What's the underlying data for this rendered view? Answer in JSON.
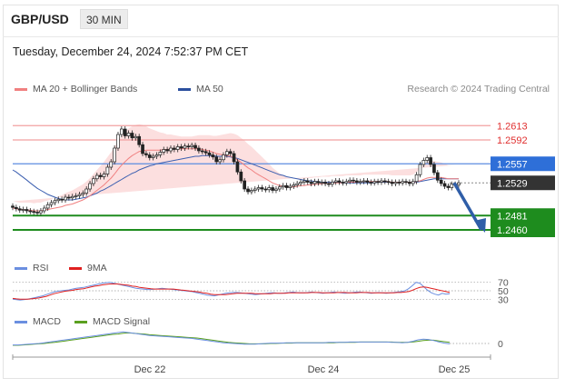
{
  "header": {
    "pair": "GBP/USD",
    "timeframe": "30 MIN",
    "datetime": "Tuesday, December 24, 2024 7:52:37 PM CET"
  },
  "legends": {
    "main": [
      {
        "label": "MA 20 + Bollinger Bands",
        "color": "#f08080"
      },
      {
        "label": "MA 50",
        "color": "#2b4f9e"
      }
    ],
    "rsi": [
      {
        "label": "RSI",
        "color": "#6b8fe0"
      },
      {
        "label": "9MA",
        "color": "#e02020"
      }
    ],
    "macd": [
      {
        "label": "MACD",
        "color": "#6b8fe0"
      },
      {
        "label": "MACD Signal",
        "color": "#5aa020"
      }
    ]
  },
  "watermark": "Research © 2024 Trading Central",
  "chart_data": {
    "type": "candlestick",
    "ylim": [
      1.244,
      1.264
    ],
    "x_ticks": [
      "Dec 22",
      "Dec 24",
      "Dec 25"
    ],
    "levels": [
      {
        "value": "1.2613",
        "kind": "resistance",
        "color": "#e03030"
      },
      {
        "value": "1.2592",
        "kind": "resistance",
        "color": "#e03030"
      },
      {
        "value": "1.2557",
        "kind": "pivot",
        "color": "#2e6fd8"
      },
      {
        "value": "1.2529",
        "kind": "last",
        "color": "#333333"
      },
      {
        "value": "1.2481",
        "kind": "support",
        "color": "#1e8c1e"
      },
      {
        "value": "1.2460",
        "kind": "support",
        "color": "#1e8c1e"
      }
    ],
    "close": [
      1.2493,
      1.2491,
      1.2489,
      1.249,
      1.2488,
      1.2487,
      1.2486,
      1.2485,
      1.2488,
      1.2492,
      1.2497,
      1.25,
      1.2503,
      1.2505,
      1.2504,
      1.2508,
      1.2507,
      1.2509,
      1.251,
      1.2512,
      1.2514,
      1.252,
      1.2528,
      1.2535,
      1.254,
      1.2538,
      1.2542,
      1.2552,
      1.256,
      1.258,
      1.26,
      1.2608,
      1.2598,
      1.2602,
      1.2595,
      1.2597,
      1.2585,
      1.2572,
      1.257,
      1.2566,
      1.2568,
      1.257,
      1.2574,
      1.2578,
      1.2576,
      1.258,
      1.2578,
      1.2582,
      1.258,
      1.2583,
      1.2582,
      1.2584,
      1.258,
      1.2576,
      1.2575,
      1.2573,
      1.257,
      1.2567,
      1.256,
      1.2563,
      1.257,
      1.2575,
      1.2572,
      1.256,
      1.2545,
      1.2532,
      1.252,
      1.2516,
      1.2518,
      1.252,
      1.2522,
      1.252,
      1.2519,
      1.2522,
      1.2518,
      1.252,
      1.2523,
      1.2525,
      1.2522,
      1.2524,
      1.2526,
      1.2528,
      1.253,
      1.2532,
      1.253,
      1.2528,
      1.2531,
      1.2529,
      1.253,
      1.2528,
      1.2527,
      1.253,
      1.2532,
      1.253,
      1.2529,
      1.2531,
      1.2533,
      1.2532,
      1.253,
      1.2531,
      1.2532,
      1.253,
      1.2529,
      1.2531,
      1.253,
      1.2532,
      1.2531,
      1.253,
      1.2528,
      1.253,
      1.2529,
      1.2531,
      1.253,
      1.2528,
      1.2531,
      1.2541,
      1.2556,
      1.2562,
      1.2566,
      1.2556,
      1.2544,
      1.2533,
      1.2528,
      1.2524,
      1.2522,
      1.2527,
      1.2526,
      1.2529
    ],
    "ma20": [
      1.2492,
      1.2491,
      1.249,
      1.249,
      1.2489,
      1.2489,
      1.2488,
      1.2488,
      1.2488,
      1.2489,
      1.249,
      1.2491,
      1.2492,
      1.2493,
      1.2494,
      1.2496,
      1.2497,
      1.2498,
      1.25,
      1.2502,
      1.2504,
      1.2507,
      1.251,
      1.2514,
      1.2518,
      1.2522,
      1.2526,
      1.2531,
      1.2536,
      1.2542,
      1.2549,
      1.2555,
      1.256,
      1.2565,
      1.2569,
      1.2572,
      1.2575,
      1.2576,
      1.2577,
      1.2577,
      1.2577,
      1.2577,
      1.2577,
      1.2578,
      1.2578,
      1.2579,
      1.2579,
      1.2579,
      1.2579,
      1.2579,
      1.2579,
      1.2579,
      1.2579,
      1.2579,
      1.2578,
      1.2577,
      1.2576,
      1.2574,
      1.2572,
      1.2571,
      1.257,
      1.2569,
      1.2568,
      1.2566,
      1.2563,
      1.2559,
      1.2555,
      1.2551,
      1.2548,
      1.2544,
      1.2541,
      1.2538,
      1.2535,
      1.2532,
      1.2529,
      1.2527,
      1.2525,
      1.2524,
      1.2523,
      1.2523,
      1.2523,
      1.2524,
      1.2525,
      1.2525,
      1.2526,
      1.2526,
      1.2527,
      1.2527,
      1.2528,
      1.2528,
      1.2528,
      1.2529,
      1.2529,
      1.2529,
      1.2529,
      1.253,
      1.253,
      1.253,
      1.253,
      1.253,
      1.2531,
      1.2531,
      1.2531,
      1.2531,
      1.2531,
      1.2531,
      1.2531,
      1.2531,
      1.253,
      1.253,
      1.253,
      1.253,
      1.253,
      1.253,
      1.253,
      1.2531,
      1.2532,
      1.2534,
      1.2536,
      1.2537,
      1.2537,
      1.2537,
      1.2537,
      1.2536,
      1.2535,
      1.2535,
      1.2535,
      1.2535
    ],
    "ma50": [
      1.2548,
      1.2545,
      1.2541,
      1.2537,
      1.2533,
      1.2529,
      1.2525,
      1.2521,
      1.2518,
      1.2515,
      1.2512,
      1.251,
      1.2508,
      1.2506,
      1.2505,
      1.2504,
      1.2504,
      1.2504,
      1.2505,
      1.2506,
      1.2507,
      1.2508,
      1.251,
      1.2512,
      1.2514,
      1.2517,
      1.2519,
      1.2522,
      1.2525,
      1.2528,
      1.2531,
      1.2534,
      1.2537,
      1.254,
      1.2543,
      1.2545,
      1.2548,
      1.255,
      1.2552,
      1.2554,
      1.2555,
      1.2557,
      1.2558,
      1.2559,
      1.256,
      1.2561,
      1.2562,
      1.2563,
      1.2564,
      1.2565,
      1.2566,
      1.2567,
      1.2568,
      1.2568,
      1.2569,
      1.2569,
      1.2569,
      1.2569,
      1.2568,
      1.2568,
      1.2568,
      1.2568,
      1.2567,
      1.2566,
      1.2565,
      1.2563,
      1.2561,
      1.2559,
      1.2557,
      1.2555,
      1.2553,
      1.2551,
      1.2549,
      1.2547,
      1.2545,
      1.2543,
      1.2541,
      1.254,
      1.2538,
      1.2537,
      1.2536,
      1.2535,
      1.2534,
      1.2533,
      1.2532,
      1.2532,
      1.2531,
      1.2531,
      1.253,
      1.253,
      1.253,
      1.253,
      1.253,
      1.2529,
      1.2529,
      1.2529,
      1.2529,
      1.2529,
      1.2529,
      1.2529,
      1.2529,
      1.2529,
      1.2529,
      1.2529,
      1.253,
      1.253,
      1.253,
      1.253,
      1.253,
      1.253,
      1.253,
      1.253,
      1.253,
      1.253,
      1.253,
      1.253,
      1.2531,
      1.2532,
      1.2533,
      1.2534,
      1.2535,
      1.2535,
      1.2535,
      1.2535,
      1.2535,
      1.2535,
      1.2535,
      1.2535
    ],
    "band_width": [
      0.001,
      0.001,
      0.001,
      0.001,
      0.0011,
      0.0011,
      0.0011,
      0.0012,
      0.0012,
      0.0013,
      0.0013,
      0.0014,
      0.0015,
      0.0016,
      0.0017,
      0.0018,
      0.0019,
      0.002,
      0.0021,
      0.0022,
      0.0023,
      0.0024,
      0.0026,
      0.0028,
      0.003,
      0.0032,
      0.0034,
      0.0036,
      0.0038,
      0.004,
      0.0042,
      0.0043,
      0.0044,
      0.0044,
      0.0043,
      0.0042,
      0.004,
      0.0038,
      0.0035,
      0.0032,
      0.003,
      0.0028,
      0.0026,
      0.0024,
      0.0022,
      0.0021,
      0.002,
      0.0019,
      0.0018,
      0.0018,
      0.0018,
      0.0018,
      0.0019,
      0.002,
      0.0021,
      0.0022,
      0.0023,
      0.0024,
      0.0026,
      0.0028,
      0.003,
      0.0032,
      0.0034,
      0.0035,
      0.0036,
      0.0036,
      0.0036,
      0.0035,
      0.0034,
      0.0033,
      0.0031,
      0.0029,
      0.0027,
      0.0025,
      0.0022,
      0.002,
      0.0018,
      0.0016,
      0.0014,
      0.0013,
      0.0012,
      0.0011,
      0.001,
      0.001,
      0.001,
      0.001,
      0.001,
      0.001,
      0.001,
      0.001,
      0.001,
      0.001,
      0.001,
      0.001,
      0.001,
      0.001,
      0.001,
      0.001,
      0.001,
      0.001,
      0.001,
      0.001,
      0.001,
      0.001,
      0.001,
      0.001,
      0.001,
      0.001,
      0.001,
      0.001,
      0.001,
      0.001,
      0.001,
      0.001,
      0.0011,
      0.0014,
      0.0018,
      0.0022,
      0.0024,
      0.0024,
      0.0024,
      0.0023,
      0.0022,
      0.0021,
      0.002,
      0.002,
      0.002
    ],
    "projection": {
      "from": 1.2529,
      "to": 1.246
    },
    "rsi": {
      "levels": [
        "70",
        "50",
        "30"
      ],
      "rsi": [
        30,
        29,
        28,
        29,
        30,
        32,
        34,
        36,
        38,
        41,
        44,
        47,
        49,
        50,
        51,
        52,
        54,
        56,
        57,
        58,
        60,
        62,
        64,
        66,
        68,
        69,
        70,
        68,
        66,
        64,
        62,
        60,
        58,
        56,
        55,
        54,
        53,
        53,
        54,
        55,
        56,
        55,
        54,
        53,
        52,
        51,
        50,
        49,
        48,
        46,
        44,
        42,
        40,
        39,
        38,
        40,
        42,
        44,
        45,
        46,
        46,
        45,
        44,
        43,
        42,
        41,
        42,
        43,
        44,
        45,
        45,
        44,
        44,
        45,
        46,
        47,
        46,
        45,
        45,
        46,
        47,
        46,
        45,
        44,
        45,
        46,
        47,
        46,
        45,
        44,
        45,
        46,
        47,
        47,
        46,
        45,
        44,
        45,
        46,
        45,
        44,
        45,
        46,
        47,
        48,
        50,
        55,
        62,
        70,
        68,
        60,
        52,
        46,
        42,
        40,
        44,
        42,
        43
      ],
      "ma9": [
        32,
        31,
        30,
        30,
        30,
        31,
        32,
        33,
        35,
        37,
        40,
        43,
        45,
        47,
        49,
        50,
        51,
        53,
        54,
        55,
        57,
        59,
        61,
        62,
        64,
        65,
        66,
        66,
        66,
        65,
        64,
        63,
        61,
        60,
        58,
        57,
        56,
        55,
        54,
        54,
        54,
        54,
        54,
        54,
        53,
        52,
        51,
        50,
        49,
        48,
        47,
        45,
        44,
        42,
        41,
        41,
        41,
        41,
        42,
        43,
        44,
        44,
        44,
        44,
        44,
        43,
        43,
        43,
        43,
        43,
        44,
        44,
        44,
        44,
        45,
        45,
        45,
        45,
        45,
        45,
        46,
        46,
        46,
        45,
        45,
        45,
        45,
        46,
        46,
        46,
        45,
        45,
        45,
        46,
        46,
        46,
        45,
        45,
        45,
        45,
        45,
        45,
        45,
        46,
        46,
        47,
        48,
        51,
        55,
        58,
        59,
        58,
        56,
        54,
        52,
        50,
        48,
        46
      ]
    },
    "macd": {
      "zero_label": "0",
      "macd": [
        -0.0004,
        -0.0004,
        -0.0003,
        -0.0002,
        -0.0001,
        0.0,
        0.0002,
        0.0004,
        0.0006,
        0.0008,
        0.001,
        0.0012,
        0.0014,
        0.0016,
        0.0018,
        0.002,
        0.0022,
        0.0024,
        0.0026,
        0.0028,
        0.003,
        0.0032,
        0.003,
        0.0028,
        0.0026,
        0.0024,
        0.0022,
        0.0021,
        0.002,
        0.0019,
        0.0018,
        0.0017,
        0.0016,
        0.0015,
        0.0014,
        0.0012,
        0.001,
        0.0008,
        0.0006,
        0.0004,
        0.0002,
        0.0001,
        0.0,
        -0.0001,
        -0.0002,
        -0.0002,
        -0.0002,
        -0.0001,
        0.0,
        0.0001,
        0.0001,
        0.0001,
        0.0002,
        0.0002,
        0.0002,
        0.0002,
        0.0002,
        0.0002,
        0.0002,
        0.0002,
        0.0003,
        0.0003,
        0.0003,
        0.0003,
        0.0004,
        0.0004,
        0.0004,
        0.0004,
        0.0004,
        0.0004,
        0.0004,
        0.0004,
        0.0003,
        0.0003,
        0.0002,
        0.0003,
        0.0006,
        0.001,
        0.0012,
        0.0011,
        0.0008,
        0.0004,
        0.0001,
        -0.0001
      ],
      "signal": [
        -0.0005,
        -0.0005,
        -0.0004,
        -0.0003,
        -0.0002,
        -0.0001,
        0.0,
        0.0002,
        0.0003,
        0.0005,
        0.0007,
        0.0009,
        0.0011,
        0.0013,
        0.0015,
        0.0017,
        0.0019,
        0.0021,
        0.0023,
        0.0025,
        0.0026,
        0.0028,
        0.0029,
        0.0028,
        0.0027,
        0.0026,
        0.0024,
        0.0023,
        0.0022,
        0.0021,
        0.002,
        0.0019,
        0.0018,
        0.0017,
        0.0016,
        0.0015,
        0.0013,
        0.0011,
        0.0009,
        0.0007,
        0.0005,
        0.0003,
        0.0002,
        0.0001,
        0.0,
        -0.0001,
        -0.0001,
        -0.0001,
        -0.0001,
        0.0,
        0.0,
        0.0001,
        0.0001,
        0.0001,
        0.0002,
        0.0002,
        0.0002,
        0.0002,
        0.0002,
        0.0002,
        0.0002,
        0.0002,
        0.0003,
        0.0003,
        0.0003,
        0.0003,
        0.0004,
        0.0004,
        0.0004,
        0.0004,
        0.0004,
        0.0004,
        0.0004,
        0.0003,
        0.0003,
        0.0003,
        0.0004,
        0.0006,
        0.0008,
        0.0009,
        0.0009,
        0.0007,
        0.0005,
        0.0003
      ]
    }
  }
}
